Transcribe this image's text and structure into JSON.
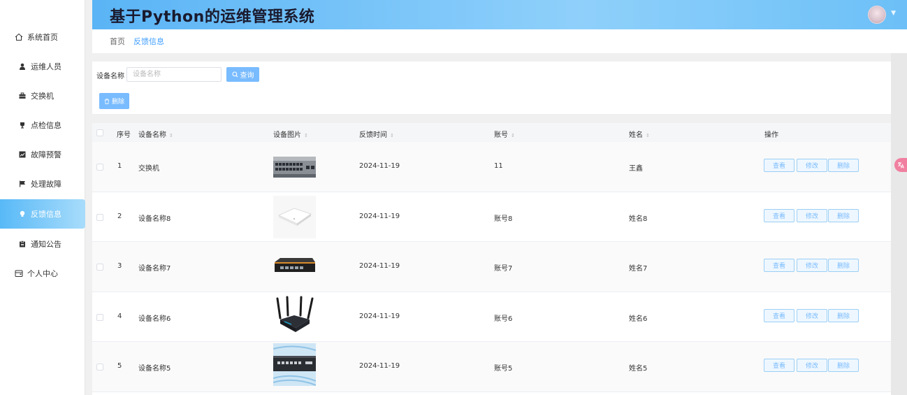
{
  "header": {
    "title": "基于Python的运维管理系统"
  },
  "breadcrumb": {
    "home": "首页",
    "current": "反馈信息"
  },
  "sidebar": {
    "items": [
      {
        "label": "系统首页",
        "icon": "home-icon"
      },
      {
        "label": "运维人员",
        "icon": "user-icon"
      },
      {
        "label": "交换机",
        "icon": "briefcase-icon"
      },
      {
        "label": "点检信息",
        "icon": "trophy-icon"
      },
      {
        "label": "故障预警",
        "icon": "chart-icon"
      },
      {
        "label": "处理故障",
        "icon": "flag-icon"
      },
      {
        "label": "反馈信息",
        "icon": "bulb-icon"
      },
      {
        "label": "通知公告",
        "icon": "clipboard-icon"
      },
      {
        "label": "个人中心",
        "icon": "wallet-icon"
      }
    ]
  },
  "search": {
    "label": "设备名称",
    "placeholder": "设备名称",
    "value": "",
    "query_label": "查询"
  },
  "toolbar": {
    "delete_label": "删除"
  },
  "table": {
    "columns": [
      "序号",
      "设备名称",
      "设备图片",
      "反馈时间",
      "账号",
      "姓名",
      "操作"
    ],
    "actions": {
      "view": "查看",
      "edit": "修改",
      "delete": "删除"
    },
    "rows": [
      {
        "index": "1",
        "name": "交换机",
        "image": "switch-device",
        "time": "2024-11-19",
        "account": "11",
        "person": "王鑫"
      },
      {
        "index": "2",
        "name": "设备名称8",
        "image": "access-point",
        "time": "2024-11-19",
        "account": "账号8",
        "person": "姓名8"
      },
      {
        "index": "3",
        "name": "设备名称7",
        "image": "black-switch",
        "time": "2024-11-19",
        "account": "账号7",
        "person": "姓名7"
      },
      {
        "index": "4",
        "name": "设备名称6",
        "image": "wifi-router",
        "time": "2024-11-19",
        "account": "账号6",
        "person": "姓名6"
      },
      {
        "index": "5",
        "name": "设备名称5",
        "image": "rack-switch",
        "time": "2024-11-19",
        "account": "账号5",
        "person": "姓名5"
      }
    ]
  },
  "colors": {
    "accent": "#409eff",
    "button": "#79bbff",
    "header_gradient_start": "#5ab4f5",
    "header_gradient_end": "#8fd0fb"
  }
}
